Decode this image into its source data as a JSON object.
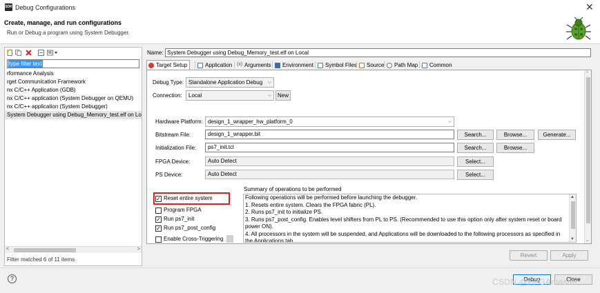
{
  "window": {
    "title": "Debug Configurations",
    "app_icon": "SDK",
    "close_glyph": "✕"
  },
  "header": {
    "heading": "Create, manage, and run configurations",
    "subheading": "Run or Debug a program using System Debugger."
  },
  "left": {
    "filter_text": "type filter text",
    "tree": [
      "rformance Analysis",
      "rget Communication Framework",
      "nx C/C++ Application (GDB)",
      "nx C/C++ application (System Debugger on QEMU)",
      "nx C/C++ application (System Debugger)",
      "System Debugger using Debug_Memory_test.elf on Loc"
    ],
    "status": "Filter matched 6 of 11 items"
  },
  "name": {
    "label": "Name:",
    "value": "System Debugger using Debug_Memory_test.elf on Local"
  },
  "tabs": [
    {
      "label": "Target Setup",
      "icon": "target-icon",
      "color": "#d23c2c"
    },
    {
      "label": "Application",
      "icon": "application-icon",
      "color": "#4a72b8"
    },
    {
      "label": "Arguments",
      "icon": "arguments-icon",
      "color": "#555555"
    },
    {
      "label": "Environment",
      "icon": "environment-icon",
      "color": "#3c6ea0"
    },
    {
      "label": "Symbol Files",
      "icon": "symbol-files-icon",
      "color": "#4a8a4a"
    },
    {
      "label": "Source",
      "icon": "source-icon",
      "color": "#b07a30"
    },
    {
      "label": "Path Map",
      "icon": "path-map-icon",
      "color": "#777777"
    },
    {
      "label": "Common",
      "icon": "common-icon",
      "color": "#5577aa"
    }
  ],
  "target": {
    "debug_type_label": "Debug Type:",
    "debug_type_value": "Standalone Application Debug",
    "connection_label": "Connection:",
    "connection_value": "Local",
    "new_label": "New",
    "hw_platform_label": "Hardware Platform:",
    "hw_platform_value": "design_1_wrapper_hw_platform_0",
    "bitstream_label": "Bitstream File:",
    "bitstream_value": "design_1_wrapper.bit",
    "init_label": "Initialization File:",
    "init_value": "ps7_init.tcl",
    "fpga_label": "FPGA Device:",
    "fpga_value": "Auto Detect",
    "ps_label": "PS Device:",
    "ps_value": "Auto Detect",
    "search_label": "Search...",
    "browse_label": "Browse...",
    "generate_label": "Generate...",
    "select_label": "Select..."
  },
  "options": [
    {
      "label": "Reset entire system",
      "checked": true
    },
    {
      "label": "Program FPGA",
      "checked": false
    },
    {
      "label": "Run ps7_init",
      "checked": true
    },
    {
      "label": "Run ps7_post_config",
      "checked": true
    },
    {
      "label": "Enable Cross-Triggering",
      "checked": false
    }
  ],
  "summary": {
    "heading": "Summary of operations to be performed",
    "lines": [
      "Following operations will be performed before launching the debugger.",
      "1. Resets entire system. Clears the FPGA fabric (PL).",
      "2. Runs ps7_init to initialize PS.",
      "3. Runs ps7_post_config. Enables level shifters from PL to PS. (Recommended to use this option only after system reset or board power ON).",
      "4. All processors in the system will be suspended, and Applications will be downloaded to the following processors as specified in the Applications tab."
    ]
  },
  "actions": {
    "revert": "Revert",
    "apply": "Apply",
    "debug": "Debug",
    "close": "Close"
  },
  "watermark": "CSDN @FPGAmaster",
  "help_glyph": "?"
}
